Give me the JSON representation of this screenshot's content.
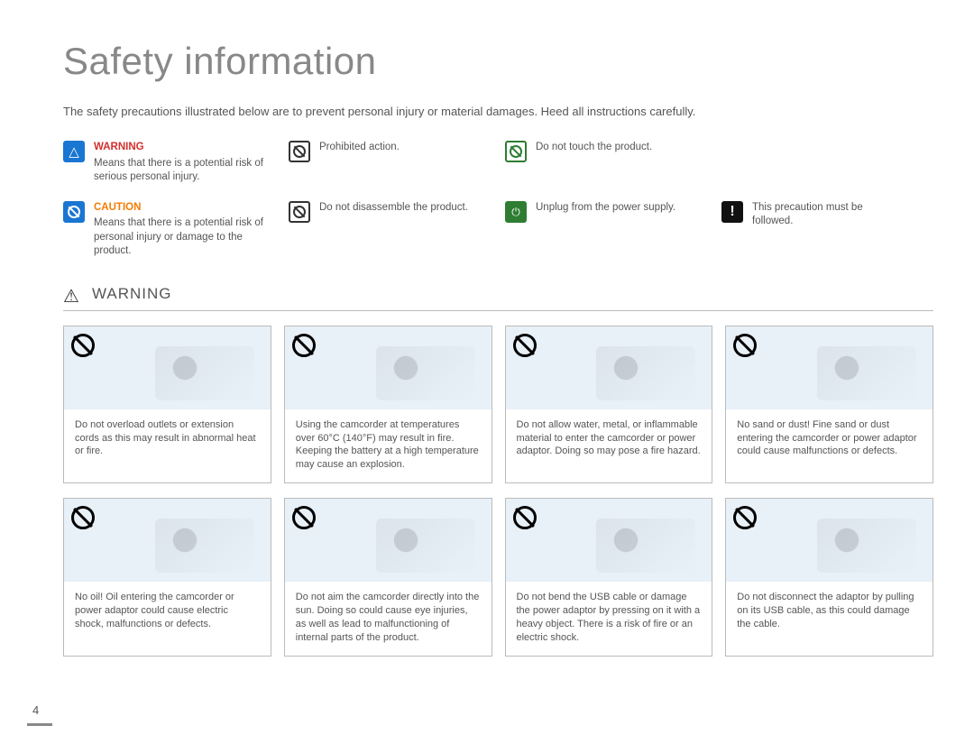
{
  "title": "Safety information",
  "intro": "The safety precautions illustrated below are to prevent personal injury or material damages. Heed all instructions carefully.",
  "legend": {
    "warning_title": "WARNING",
    "warning_text": "Means that there is a potential risk of serious personal injury.",
    "caution_title": "CAUTION",
    "caution_text": "Means that there is a potential risk of personal injury or damage to the product.",
    "prohibited": "Prohibited action.",
    "disassemble": "Do not disassemble the product.",
    "no_touch": "Do not touch the product.",
    "unplug": "Unplug from the power supply.",
    "must_follow": "This precaution must be followed."
  },
  "section_label": "WARNING",
  "cards": [
    "Do not overload outlets or extension cords as this may result in abnormal heat or fire.",
    "Using the camcorder at temperatures over 60°C (140°F) may result in fire. Keeping the battery at a high temperature may cause an explosion.",
    "Do not allow water, metal, or inflammable material to enter the camcorder or power adaptor. Doing so may pose a fire hazard.",
    "No sand or dust! Fine sand or dust entering the camcorder or power adaptor could cause malfunctions or defects.",
    "No oil! Oil entering the camcorder or power adaptor could cause electric shock, malfunctions or defects.",
    "Do not aim the camcorder directly into the sun. Doing so could cause eye injuries, as well as lead to malfunctioning of internal parts of the product.",
    "Do not bend the USB cable or damage the power adaptor by pressing on it with a heavy object. There is a risk of fire or an electric shock.",
    "Do not disconnect the adaptor by pulling on its USB cable, as this could damage the cable."
  ],
  "page_number": "4"
}
